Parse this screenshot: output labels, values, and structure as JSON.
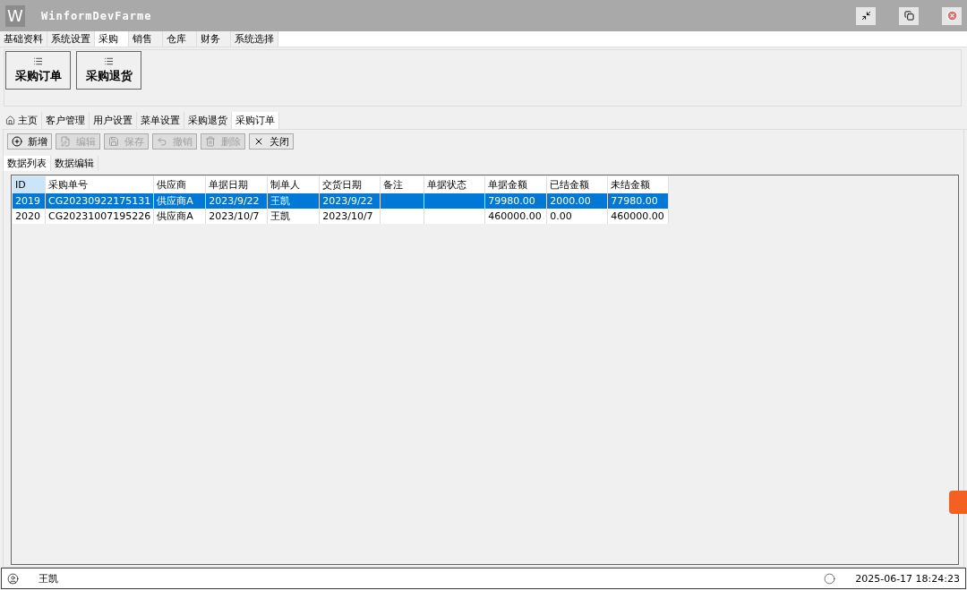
{
  "window": {
    "logo": "W",
    "title": "WinformDevFarme"
  },
  "menu_tabs": [
    {
      "label": "基础资料",
      "selected": false
    },
    {
      "label": "系统设置",
      "selected": false
    },
    {
      "label": "采购",
      "selected": true
    },
    {
      "label": "销售",
      "selected": false
    },
    {
      "label": "仓库",
      "selected": false
    },
    {
      "label": "财务",
      "selected": false
    },
    {
      "label": "系统选择",
      "selected": false
    }
  ],
  "ribbon_buttons": [
    "采购订单",
    "采购退货"
  ],
  "document_tabs": [
    {
      "label": "主页",
      "kind": "home",
      "selected": false
    },
    {
      "label": "客户管理",
      "kind": "plain",
      "selected": false
    },
    {
      "label": "用户设置",
      "kind": "plain",
      "selected": false
    },
    {
      "label": "菜单设置",
      "kind": "plain",
      "selected": false
    },
    {
      "label": "采购退货",
      "kind": "plain",
      "selected": false
    },
    {
      "label": "采购订单",
      "kind": "plain",
      "selected": true
    }
  ],
  "toolbar": [
    {
      "label": "新增",
      "kind": "add",
      "disabled": false
    },
    {
      "label": "编辑",
      "kind": "edit",
      "disabled": true
    },
    {
      "label": "保存",
      "kind": "save",
      "disabled": true
    },
    {
      "label": "撤销",
      "kind": "undo",
      "disabled": true
    },
    {
      "label": "删除",
      "kind": "delete",
      "disabled": true
    },
    {
      "label": "关闭",
      "kind": "close",
      "disabled": false
    }
  ],
  "sub_tabs": [
    {
      "label": "数据列表",
      "selected": true
    },
    {
      "label": "数据编辑",
      "selected": false
    }
  ],
  "table": {
    "columns": [
      "ID",
      "采购单号",
      "供应商",
      "单据日期",
      "制单人",
      "交货日期",
      "备注",
      "单据状态",
      "单据金额",
      "已结金额",
      "未结金额"
    ],
    "rows": [
      {
        "selected": true,
        "cells": [
          "2019",
          "CG20230922175131",
          "供应商A",
          "2023/9/22",
          "王凯",
          "2023/9/22",
          "",
          "",
          "79980.00",
          "2000.00",
          "77980.00"
        ]
      },
      {
        "selected": false,
        "cells": [
          "2020",
          "CG20231007195226",
          "供应商A",
          "2023/10/7",
          "王凯",
          "2023/10/7",
          "",
          "",
          "460000.00",
          "0.00",
          "460000.00"
        ]
      }
    ]
  },
  "status_bar": {
    "user": "王凯",
    "datetime": "2025-06-17 18:24:23"
  }
}
